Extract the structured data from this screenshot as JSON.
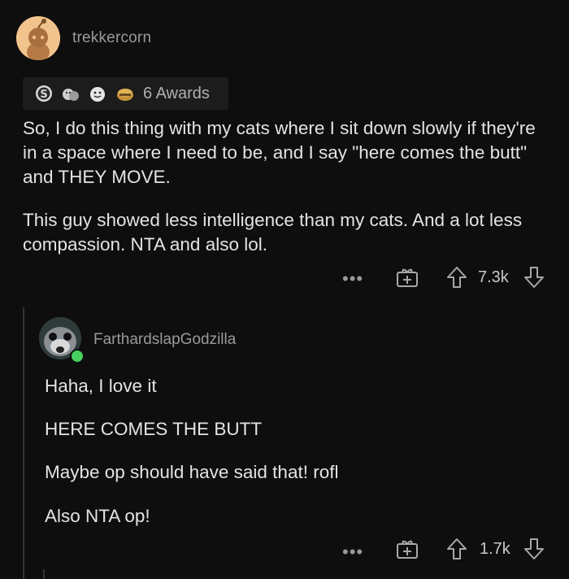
{
  "comment": {
    "username": "trekkercorn",
    "awards_label": "6 Awards",
    "awards": [
      "silver-award-icon",
      "hug-award-icon",
      "wholesome-award-icon",
      "gold-award-icon"
    ],
    "paragraphs": [
      "So, I do this thing with my cats where I sit down slowly if they're in a space where I need to be, and I say \"here comes the butt\" and THEY MOVE.",
      "This guy showed less intelligence than my cats. And a lot less compassion. NTA and also lol."
    ],
    "actions": {
      "more_label": "•••",
      "vote_count": "7.3k"
    }
  },
  "reply": {
    "username": "FarthardslapGodzilla",
    "online": true,
    "paragraphs": [
      "Haha, I love it",
      "HERE COMES THE BUTT",
      "Maybe op should have said that! rofl",
      "Also NTA op!"
    ],
    "actions": {
      "more_label": "•••",
      "vote_count": "1.7k"
    }
  },
  "colors": {
    "background": "#0e0e0e",
    "text": "#e3e3e3",
    "muted": "#9a9a9a",
    "online": "#46d160",
    "avatar_main": "#f2c48d"
  }
}
